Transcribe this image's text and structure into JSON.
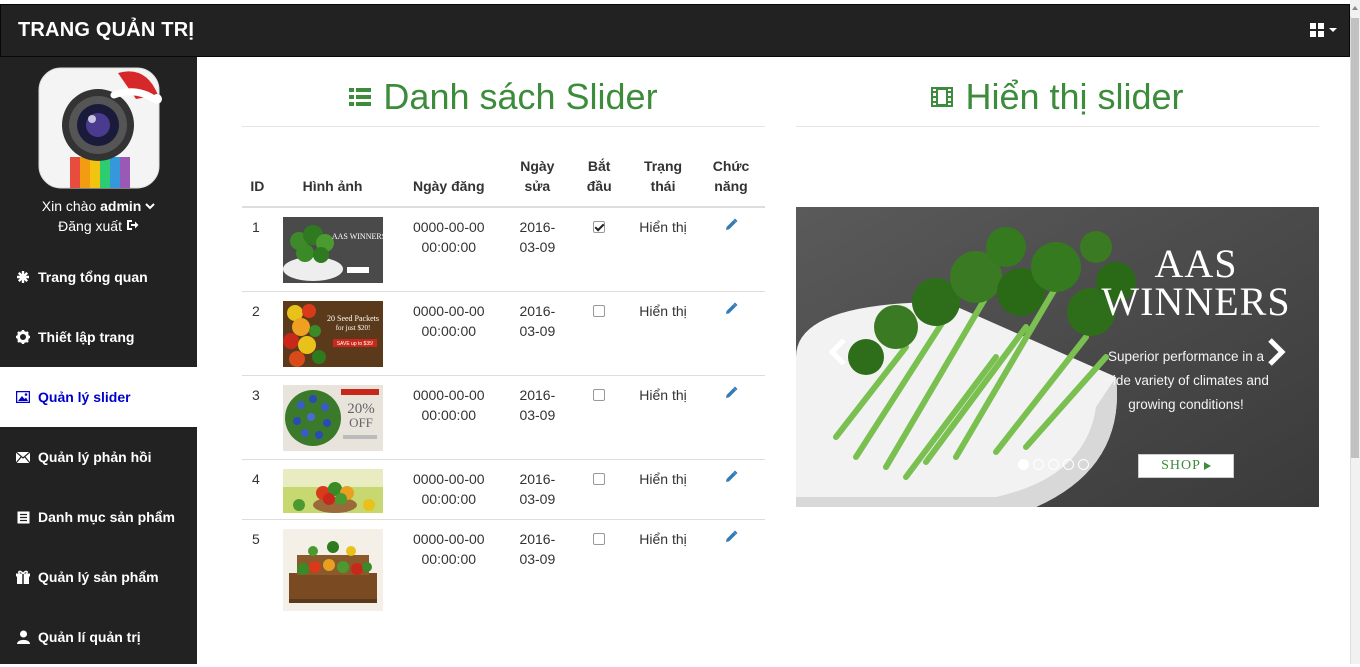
{
  "app": {
    "title": "TRANG QUẢN TRỊ"
  },
  "header": {
    "menu_icon": "grid-icon"
  },
  "sidebar": {
    "greeting_prefix": "Xin chào",
    "username": "admin",
    "logout_label": "Đăng xuất",
    "items": [
      {
        "label": "Trang tổng quan",
        "icon": "asterisk-icon",
        "active": false
      },
      {
        "label": "Thiết lập trang",
        "icon": "gear-icon",
        "active": false
      },
      {
        "label": "Quản lý slider",
        "icon": "picture-icon",
        "active": true
      },
      {
        "label": "Quản lý phản hồi",
        "icon": "envelope-icon",
        "active": false
      },
      {
        "label": "Danh mục sản phẩm",
        "icon": "list-alt-icon",
        "active": false
      },
      {
        "label": "Quản lý sản phẩm",
        "icon": "gift-icon",
        "active": false
      },
      {
        "label": "Quản lí quản trị",
        "icon": "user-icon",
        "active": false
      }
    ]
  },
  "list_section": {
    "title": "Danh sách Slider",
    "columns": [
      "ID",
      "Hình ảnh",
      "Ngày đăng",
      "Ngày sửa",
      "Bắt đầu",
      "Trạng thái",
      "Chức năng"
    ],
    "rows": [
      {
        "id": "1",
        "image": "broccoli",
        "created": "0000-00-00 00:00:00",
        "modified": "2016-03-09",
        "start": true,
        "status": "Hiển thị"
      },
      {
        "id": "2",
        "image": "seed-packets",
        "created": "0000-00-00 00:00:00",
        "modified": "2016-03-09",
        "start": false,
        "status": "Hiển thị"
      },
      {
        "id": "3",
        "image": "flowers-20-off",
        "created": "0000-00-00 00:00:00",
        "modified": "2016-03-09",
        "start": false,
        "status": "Hiển thị"
      },
      {
        "id": "4",
        "image": "vegetable-basket",
        "created": "0000-00-00 00:00:00",
        "modified": "2016-03-09",
        "start": false,
        "status": "Hiển thị"
      },
      {
        "id": "5",
        "image": "vegetable-crate",
        "created": "0000-00-00 00:00:00",
        "modified": "2016-03-09",
        "start": false,
        "status": "Hiển thị"
      }
    ],
    "thumb_texts": {
      "t1": "AAS WINNERS",
      "t2a": "20 Seed Packets",
      "t2b": "for just $20!",
      "t2c": "SAVE up to $35!",
      "t3a": "20%",
      "t3b": "OFF"
    }
  },
  "preview_section": {
    "title": "Hiển thị slider",
    "slide": {
      "heading_line1": "AAS",
      "heading_line2": "WINNERS",
      "subtitle_line1": "Superior performance in a",
      "subtitle_line2": "wide variety of climates and",
      "subtitle_line3": "growing conditions!",
      "button": "SHOP",
      "dot_count": 5,
      "active_dot": 0
    }
  },
  "colors": {
    "accent_green": "#3c8c3c",
    "sidebar_bg": "#222222",
    "active_link": "#0000cc",
    "edit_blue": "#337ab7"
  }
}
